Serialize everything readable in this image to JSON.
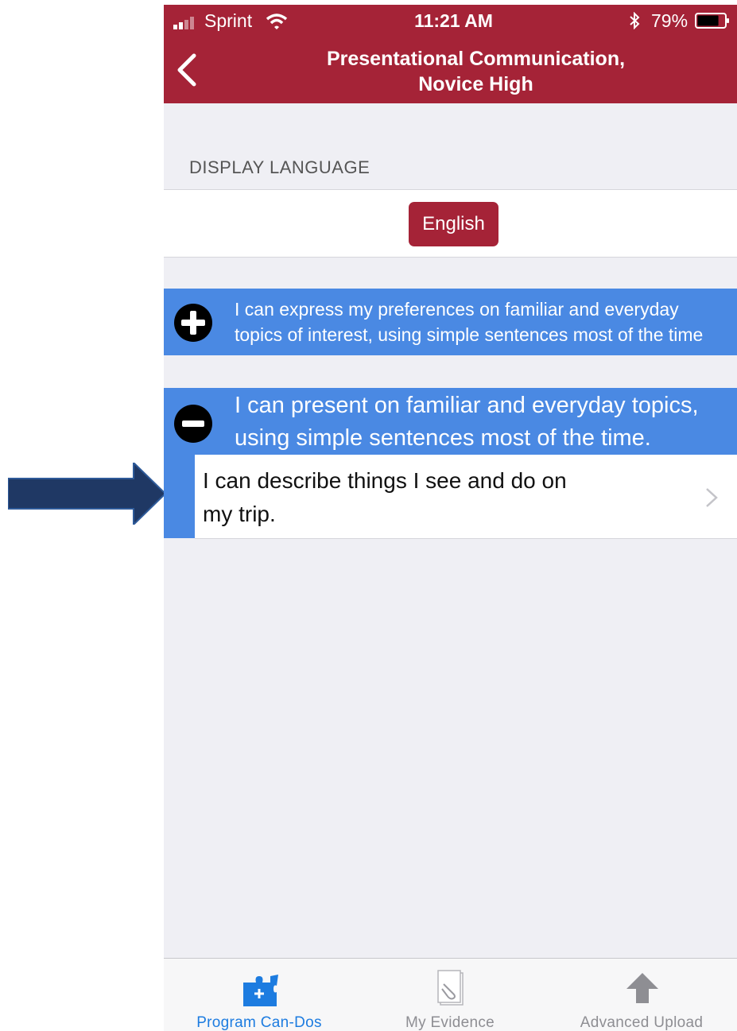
{
  "status_bar": {
    "carrier": "Sprint",
    "time": "11:21 AM",
    "battery_percent": "79%",
    "battery_level": 0.79
  },
  "nav": {
    "title_line1": "Presentational Communication,",
    "title_line2": "Novice High",
    "back_icon": "chevron-left-icon"
  },
  "display_language": {
    "section_label": "DISPLAY LANGUAGE",
    "selected_language": "English"
  },
  "can_dos": [
    {
      "text_line1": "I can express my preferences on familiar and everyday",
      "text_line2": "topics of interest, using simple sentences most of the time",
      "expanded": false,
      "icon": "plus-circle-icon"
    },
    {
      "text_line1": "I can present on familiar and everyday topics,",
      "text_line2": "using simple sentences most of the time.",
      "expanded": true,
      "icon": "minus-circle-icon",
      "items": [
        {
          "text_line1": "I can describe things I see and do on",
          "text_line2": "my trip."
        }
      ]
    }
  ],
  "tabs": [
    {
      "label": "Program Can-Dos",
      "icon": "puzzle-piece-icon",
      "active": true
    },
    {
      "label": "My Evidence",
      "icon": "document-paperclip-icon",
      "active": false
    },
    {
      "label": "Advanced Upload",
      "icon": "upload-arrow-icon",
      "active": false
    }
  ],
  "colors": {
    "brand_red": "#a52337",
    "can_do_blue": "#4a89e3",
    "active_tab_blue": "#1d7ce0",
    "annotation_arrow": "#1f3864"
  }
}
